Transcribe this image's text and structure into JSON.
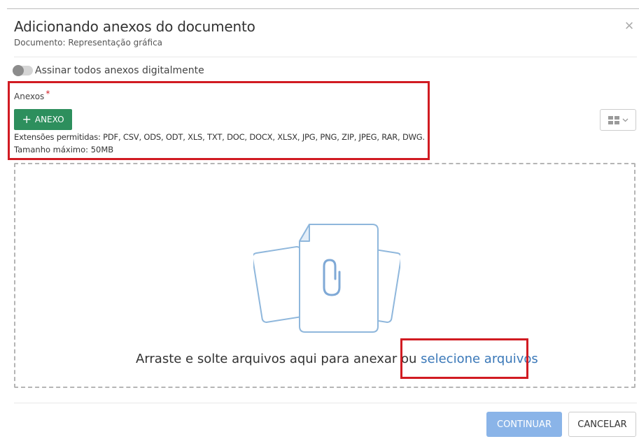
{
  "modal": {
    "title": "Adicionando anexos do documento",
    "subtitle": "Documento: Representação gráfica",
    "close_icon": "×"
  },
  "sign_toggle": {
    "label": "Assinar todos anexos digitalmente",
    "checked": false
  },
  "attachments": {
    "label": "Anexos",
    "required_mark": "*",
    "add_button_icon": "+",
    "add_button_label": "ANEXO",
    "extensions_text": "Extensões permitidas: PDF, CSV, ODS, ODT, XLS, TXT, DOC, DOCX, XLSX, JPG, PNG, ZIP, JPEG, RAR, DWG.",
    "max_size_text": "Tamanho máximo: 50MB"
  },
  "dropzone": {
    "text": "Arraste e solte arquivos aqui para anexar ou ",
    "link_text": "selecione arquivos",
    "illustration_icon": "paperclip-file-icon"
  },
  "footer": {
    "continue_label": "CONTINUAR",
    "cancel_label": "CANCELAR"
  },
  "colors": {
    "primary_green": "#2d8f5d",
    "continue_blue": "#8ab4e8",
    "link_blue": "#3a78b8",
    "highlight_red": "#d11b22"
  }
}
